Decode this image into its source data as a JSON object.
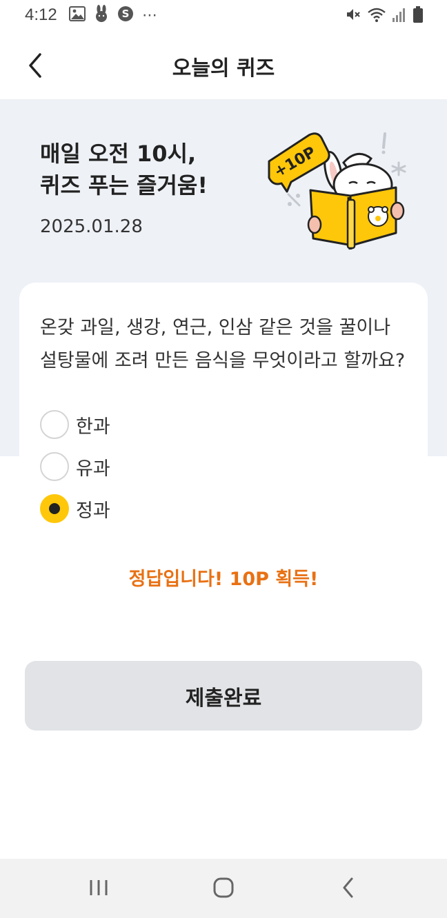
{
  "status_bar": {
    "time": "4:12",
    "more_label": "⋯",
    "left_icons": [
      "gallery-icon",
      "rabbit-notification-icon",
      "s-notification-icon"
    ],
    "right_icons": [
      "mute-icon",
      "wifi-icon",
      "signal-icon",
      "battery-icon"
    ]
  },
  "header": {
    "title": "오늘의 퀴즈",
    "back_icon": "chevron-left-icon"
  },
  "hero": {
    "title_line1": "매일 오전 10시,",
    "title_line2": "퀴즈 푸는 즐거움!",
    "date": "2025.01.28",
    "badge_label": "+10P"
  },
  "quiz": {
    "question": "온갖 과일, 생강, 연근, 인삼 같은 것을 꿀이나 설탕물에 조려 만든 음식을 무엇이라고 할까요?",
    "options": [
      {
        "label": "한과",
        "selected": false
      },
      {
        "label": "유과",
        "selected": false
      },
      {
        "label": "정과",
        "selected": true
      }
    ]
  },
  "result": {
    "message": "정답입니다! 10P 획득!"
  },
  "submit": {
    "label": "제출완료"
  },
  "nav": {
    "icons": [
      "recent-apps-icon",
      "home-icon",
      "back-icon"
    ]
  },
  "colors": {
    "accent": "#ffc70a",
    "result": "#e87114",
    "hero_bg": "#eef1f6",
    "button_bg": "#e1e3e6"
  }
}
